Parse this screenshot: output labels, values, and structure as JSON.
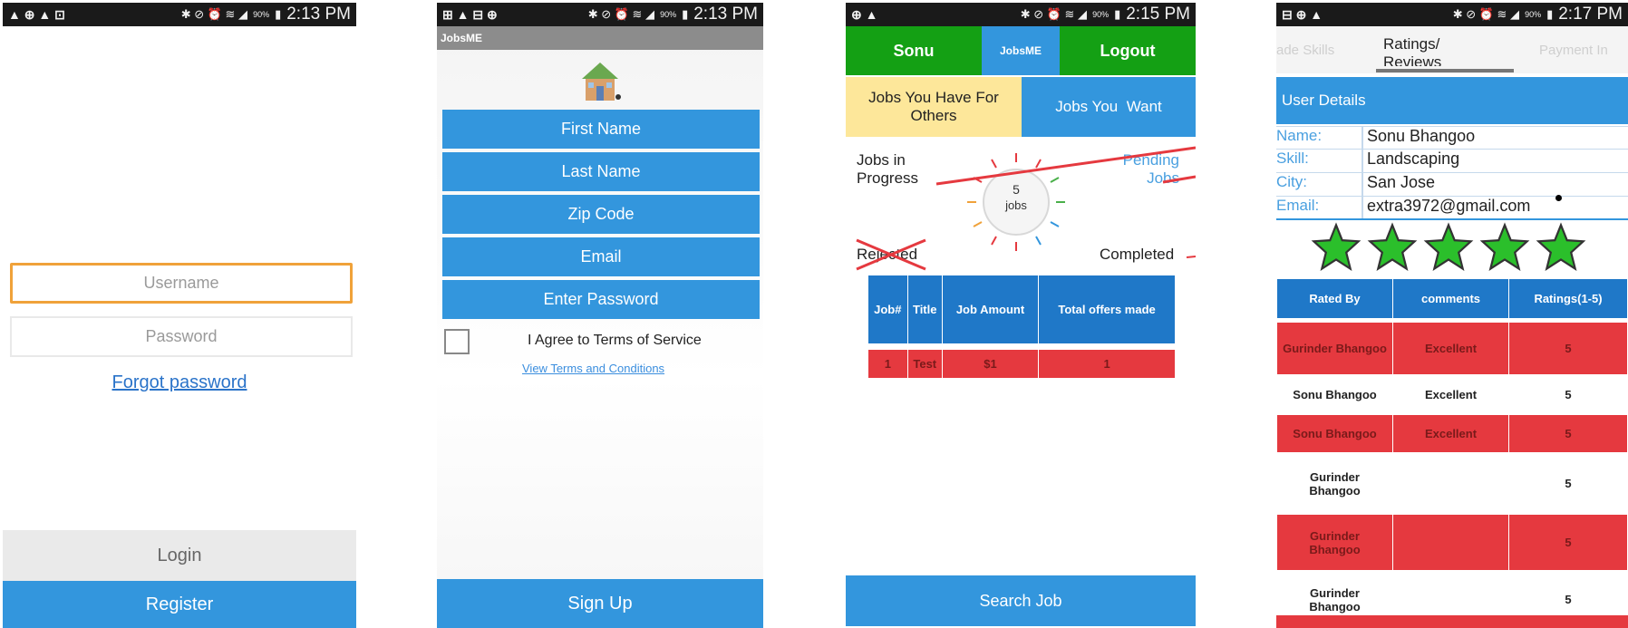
{
  "status_bars": [
    {
      "left": "▲ ⊕ ▲ ⊡",
      "right": "✱ ⊘ ⏰ ≋ ◢",
      "battery": "90%",
      "time": "2:13 PM"
    },
    {
      "left": "⊞ ▲ ⊟ ⊕",
      "right": "✱ ⊘ ⏰ ≋ ◢",
      "battery": "90%",
      "time": "2:13 PM"
    },
    {
      "left": "⊕ ▲",
      "right": "✱ ⊘ ⏰ ≋ ◢",
      "battery": "90%",
      "time": "2:15 PM"
    },
    {
      "left": "⊟ ⊕ ▲",
      "right": "✱ ⊘ ⏰ ≋ ◢",
      "battery": "90%",
      "time": "2:17 PM"
    }
  ],
  "login": {
    "username_placeholder": "Username",
    "password_placeholder": "Password",
    "forgot": "Forgot password",
    "login_btn": "Login",
    "register_btn": "Register"
  },
  "signup": {
    "app_bar_title": "JobsME",
    "fields": [
      "First Name",
      "Last Name",
      "Zip Code",
      "Email",
      "Enter Password"
    ],
    "agree": "I Agree to Terms of Service",
    "terms_link": "View Terms and Conditions",
    "signup_btn": "Sign Up"
  },
  "dashboard": {
    "nav": {
      "user": "Sonu",
      "app": "JobsME",
      "logout": "Logout"
    },
    "tabs": {
      "for_others": "Jobs You Have For Others",
      "you_want": "Jobs You  Want"
    },
    "jobs_in_progress": "Jobs in Progress",
    "pending_jobs": "Pending Jobs",
    "dial_count": "5",
    "dial_unit": "jobs",
    "rejected": "Rejected",
    "completed": "Completed",
    "table_headers": [
      "Job#",
      "Title",
      "Job Amount",
      "Total offers made"
    ],
    "table_row": [
      "1",
      "Test",
      "$1",
      "1"
    ],
    "search_btn": "Search Job"
  },
  "profile": {
    "tabs": [
      "ade Skills",
      "Ratings/ Reviews",
      "Payment In"
    ],
    "section_title": "User Details",
    "details": [
      {
        "label": "Name:",
        "value": "Sonu Bhangoo"
      },
      {
        "label": "Skill:",
        "value": "Landscaping"
      },
      {
        "label": "City:",
        "value": "San Jose"
      },
      {
        "label": "Email:",
        "value": "extra3972@gmail.com"
      }
    ],
    "star_rating": 5,
    "reviews_headers": [
      "Rated By",
      "comments",
      "Ratings(1-5)"
    ],
    "reviews": [
      {
        "by": "Gurinder Bhangoo",
        "comment": "Excellent",
        "rating": "5"
      },
      {
        "by": "Sonu Bhangoo",
        "comment": "Excellent",
        "rating": "5"
      },
      {
        "by": "Sonu Bhangoo",
        "comment": "Excellent",
        "rating": "5"
      },
      {
        "by": "Gurinder Bhangoo",
        "comment": "",
        "rating": "5"
      },
      {
        "by": "Gurinder Bhangoo",
        "comment": "",
        "rating": "5"
      },
      {
        "by": "Gurinder Bhangoo",
        "comment": "",
        "rating": "5"
      }
    ]
  },
  "colors": {
    "blue": "#3396dd",
    "green": "#14a014",
    "red": "#e5393f",
    "yellow": "#fde79a"
  }
}
